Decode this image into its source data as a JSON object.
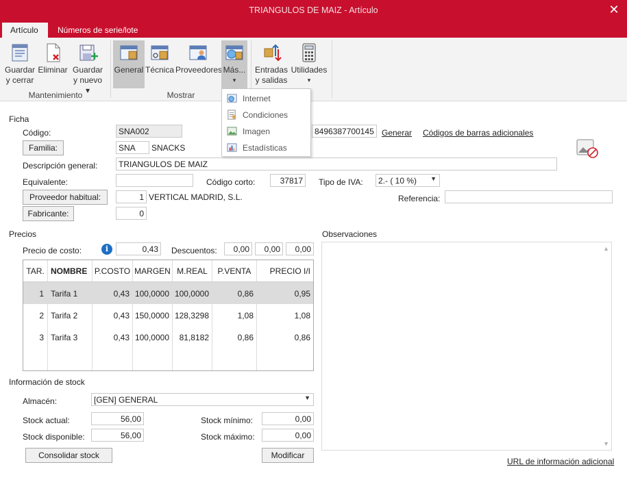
{
  "window": {
    "title": "TRIANGULOS DE MAIZ - Artículo"
  },
  "tabs": [
    "Artículo",
    "Números de serie/lote"
  ],
  "ribbon": {
    "guardar_cerrar": [
      "Guardar",
      "y cerrar"
    ],
    "eliminar": "Eliminar",
    "guardar_nuevo": [
      "Guardar",
      "y nuevo ▾"
    ],
    "mantenimiento_label": "Mantenimiento",
    "general": "General",
    "tecnica": "Técnica",
    "proveedores": "Proveedores",
    "mas": "Más...",
    "mas_arrow": "▾",
    "entradas": [
      "Entradas",
      "y salidas"
    ],
    "utilidades": "Utilidades",
    "utilidades_arrow": "▾",
    "mostrar_label": "Mostrar"
  },
  "dropdown": {
    "items": [
      "Internet",
      "Condiciones",
      "Imagen",
      "Estadísticas"
    ]
  },
  "ficha": {
    "section": "Ficha",
    "codigo_label": "Código:",
    "codigo": "SNA002",
    "barcode": "8496387700145",
    "generar": "Generar",
    "codigos_adicionales": "Códigos de barras adicionales",
    "familia_button": "Familia:",
    "familia_code": "SNA",
    "familia_name": "SNACKS",
    "descripcion_label": "Descripción general:",
    "descripcion": "TRIANGULOS DE MAIZ",
    "equivalente_label": "Equivalente:",
    "equivalente": "",
    "codigo_corto_label": "Código corto:",
    "codigo_corto": "37817",
    "tipo_iva_label": "Tipo de IVA:",
    "tipo_iva": "2.- ( 10 %)",
    "proveedor_button": "Proveedor habitual:",
    "proveedor_code": "1",
    "proveedor_name": "VERTICAL MADRID, S.L.",
    "referencia_label": "Referencia:",
    "referencia": "",
    "fabricante_button": "Fabricante:",
    "fabricante": "0"
  },
  "precios": {
    "section": "Precios",
    "precio_costo_label": "Precio de costo:",
    "precio_costo": "0,43",
    "descuentos_label": "Descuentos:",
    "descuentos": [
      "0,00",
      "0,00",
      "0,00"
    ],
    "columns": [
      "TAR.",
      "NOMBRE",
      "P.COSTO",
      "MARGEN",
      "M.REAL",
      "P.VENTA",
      "PRECIO I/I"
    ],
    "rows": [
      [
        "1",
        "Tarifa 1",
        "0,43",
        "100,0000",
        "100,0000",
        "0,86",
        "0,95"
      ],
      [
        "2",
        "Tarifa 2",
        "0,43",
        "150,0000",
        "128,3298",
        "1,08",
        "1,08"
      ],
      [
        "3",
        "Tarifa 3",
        "0,43",
        "100,0000",
        "81,8182",
        "0,86",
        "0,86"
      ]
    ]
  },
  "stock": {
    "section": "Información de stock",
    "almacen_label": "Almacén:",
    "almacen": "[GEN] GENERAL",
    "stock_actual_label": "Stock actual:",
    "stock_actual": "56,00",
    "stock_disponible_label": "Stock disponible:",
    "stock_disponible": "56,00",
    "stock_minimo_label": "Stock mínimo:",
    "stock_minimo": "0,00",
    "stock_maximo_label": "Stock máximo:",
    "stock_maximo": "0,00",
    "consolidar": "Consolidar stock",
    "modificar": "Modificar"
  },
  "observaciones": {
    "label": "Observaciones",
    "url_link": "URL de información adicional"
  },
  "colors": {
    "brand": "#c8102e",
    "ribbon_bg": "#f3f3f3",
    "selected_row": "#dcdcdc"
  }
}
